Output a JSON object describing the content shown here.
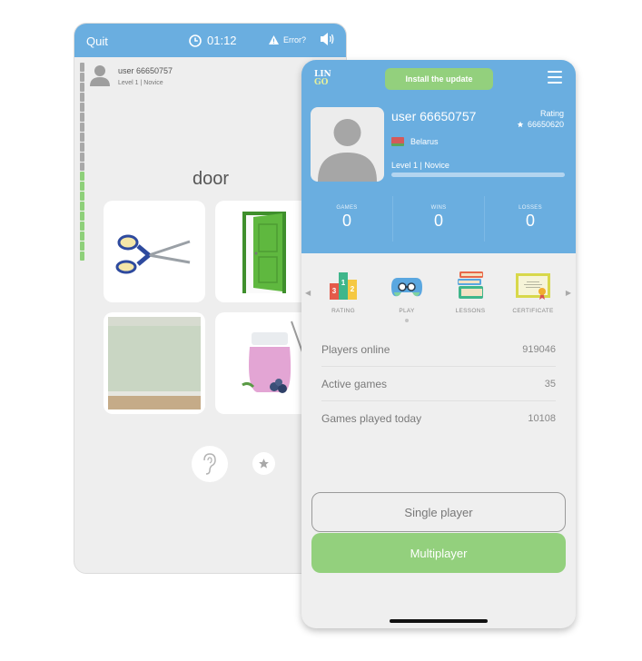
{
  "game_screen": {
    "header": {
      "quit_label": "Quit",
      "timer": "01:12",
      "error_label": "Error?",
      "icons": [
        "clock-icon",
        "warning-icon",
        "speaker-icon"
      ]
    },
    "progress": {
      "completed_segments": 9,
      "total_segments": 20
    },
    "user": {
      "name": "user 66650757",
      "level": "Level 1 | Novice"
    },
    "word": "door",
    "tiles": [
      {
        "name": "scissors"
      },
      {
        "name": "door"
      },
      {
        "name": "wall"
      },
      {
        "name": "yogurt"
      }
    ],
    "buttons": {
      "hint": "ear-question-icon",
      "favorite": "star-icon"
    }
  },
  "main_screen": {
    "logo": {
      "top": "LIN",
      "bottom": "GO"
    },
    "update_button": "Install the update",
    "profile": {
      "name": "user 66650757",
      "rating_label": "Rating",
      "rating_value": "66650620",
      "country": "Belarus",
      "level": "Level 1 | Novice",
      "level_progress": 0.0
    },
    "stats": [
      {
        "label": "GAMES",
        "value": "0"
      },
      {
        "label": "WINS",
        "value": "0"
      },
      {
        "label": "LOSSES",
        "value": "0"
      }
    ],
    "carousel": [
      {
        "label": "RATING",
        "icon": "podium-icon"
      },
      {
        "label": "PLAY",
        "icon": "gamepad-icon"
      },
      {
        "label": "LESSONS",
        "icon": "books-icon"
      },
      {
        "label": "CERTIFICATE",
        "icon": "certificate-icon"
      }
    ],
    "info": [
      {
        "label": "Players online",
        "value": "919046"
      },
      {
        "label": "Active games",
        "value": "35"
      },
      {
        "label": "Games played today",
        "value": "10108"
      }
    ],
    "single_player_label": "Single player",
    "multiplayer_label": "Multiplayer"
  },
  "colors": {
    "brand_blue": "#6aaee0",
    "brand_green": "#93d07d",
    "background": "#efefef"
  }
}
